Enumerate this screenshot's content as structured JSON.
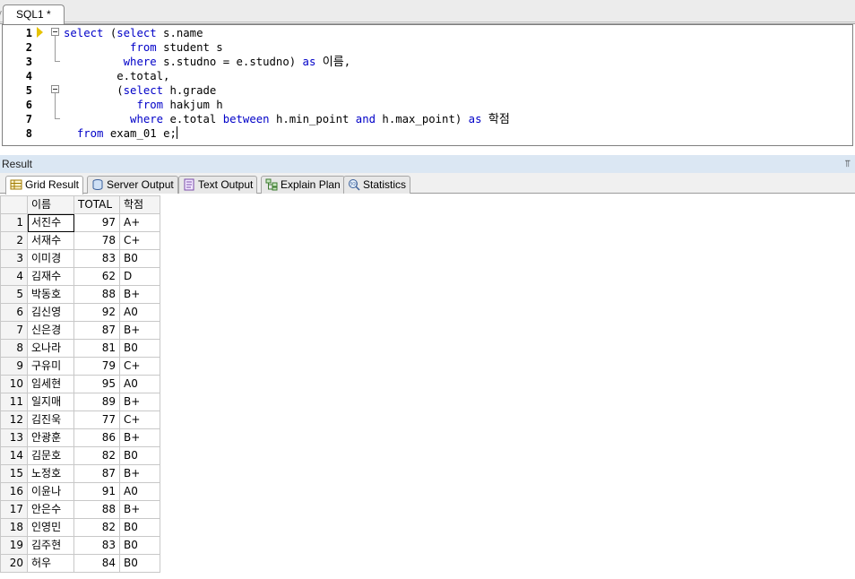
{
  "editor_tab": {
    "label": "SQL1 *"
  },
  "editor": {
    "line_numbers": [
      "1",
      "2",
      "3",
      "4",
      "5",
      "6",
      "7",
      "8"
    ],
    "lines": [
      [
        {
          "t": "select",
          "k": true
        },
        {
          "t": " (",
          "k": false
        },
        {
          "t": "select",
          "k": true
        },
        {
          "t": " s.name",
          "k": false
        }
      ],
      [
        {
          "t": "          ",
          "k": false
        },
        {
          "t": "from",
          "k": true
        },
        {
          "t": " student s",
          "k": false
        }
      ],
      [
        {
          "t": "         ",
          "k": false
        },
        {
          "t": "where",
          "k": true
        },
        {
          "t": " s.studno = e.studno) ",
          "k": false
        },
        {
          "t": "as",
          "k": true
        },
        {
          "t": " ",
          "k": false
        },
        {
          "t": "이름",
          "k": false,
          "ko": true
        },
        {
          "t": ",",
          "k": false
        }
      ],
      [
        {
          "t": "        e.total,",
          "k": false
        }
      ],
      [
        {
          "t": "        (",
          "k": false
        },
        {
          "t": "select",
          "k": true
        },
        {
          "t": " h.grade",
          "k": false
        }
      ],
      [
        {
          "t": "           ",
          "k": false
        },
        {
          "t": "from",
          "k": true
        },
        {
          "t": " hakjum h",
          "k": false
        }
      ],
      [
        {
          "t": "          ",
          "k": false
        },
        {
          "t": "where",
          "k": true
        },
        {
          "t": " e.total ",
          "k": false
        },
        {
          "t": "between",
          "k": true
        },
        {
          "t": " h.min_point ",
          "k": false
        },
        {
          "t": "and",
          "k": true
        },
        {
          "t": " h.max_point) ",
          "k": false
        },
        {
          "t": "as",
          "k": true
        },
        {
          "t": " ",
          "k": false
        },
        {
          "t": "학점",
          "k": false,
          "ko": true
        }
      ],
      [
        {
          "t": "  ",
          "k": false
        },
        {
          "t": "from",
          "k": true
        },
        {
          "t": " exam_01 e;",
          "k": false
        }
      ]
    ]
  },
  "result_panel": {
    "title": "Result"
  },
  "result_tabs": [
    {
      "label": "Grid Result",
      "icon": "grid-icon"
    },
    {
      "label": "Server Output",
      "icon": "server-output-icon"
    },
    {
      "label": "Text Output",
      "icon": "text-output-icon"
    },
    {
      "label": "Explain Plan",
      "icon": "explain-plan-icon"
    },
    {
      "label": "Statistics",
      "icon": "statistics-icon"
    }
  ],
  "grid": {
    "columns": [
      "이름",
      "TOTAL",
      "학점"
    ],
    "rows": [
      [
        "1",
        "서진수",
        "97",
        "A+"
      ],
      [
        "2",
        "서재수",
        "78",
        "C+"
      ],
      [
        "3",
        "이미경",
        "83",
        "B0"
      ],
      [
        "4",
        "김재수",
        "62",
        "D"
      ],
      [
        "5",
        "박동호",
        "88",
        "B+"
      ],
      [
        "6",
        "김신영",
        "92",
        "A0"
      ],
      [
        "7",
        "신은경",
        "87",
        "B+"
      ],
      [
        "8",
        "오나라",
        "81",
        "B0"
      ],
      [
        "9",
        "구유미",
        "79",
        "C+"
      ],
      [
        "10",
        "임세현",
        "95",
        "A0"
      ],
      [
        "11",
        "일지매",
        "89",
        "B+"
      ],
      [
        "12",
        "김진욱",
        "77",
        "C+"
      ],
      [
        "13",
        "안광훈",
        "86",
        "B+"
      ],
      [
        "14",
        "김문호",
        "82",
        "B0"
      ],
      [
        "15",
        "노정호",
        "87",
        "B+"
      ],
      [
        "16",
        "이윤나",
        "91",
        "A0"
      ],
      [
        "17",
        "안은수",
        "88",
        "B+"
      ],
      [
        "18",
        "인영민",
        "82",
        "B0"
      ],
      [
        "19",
        "김주현",
        "83",
        "B0"
      ],
      [
        "20",
        "허우",
        "84",
        "B0"
      ]
    ]
  }
}
